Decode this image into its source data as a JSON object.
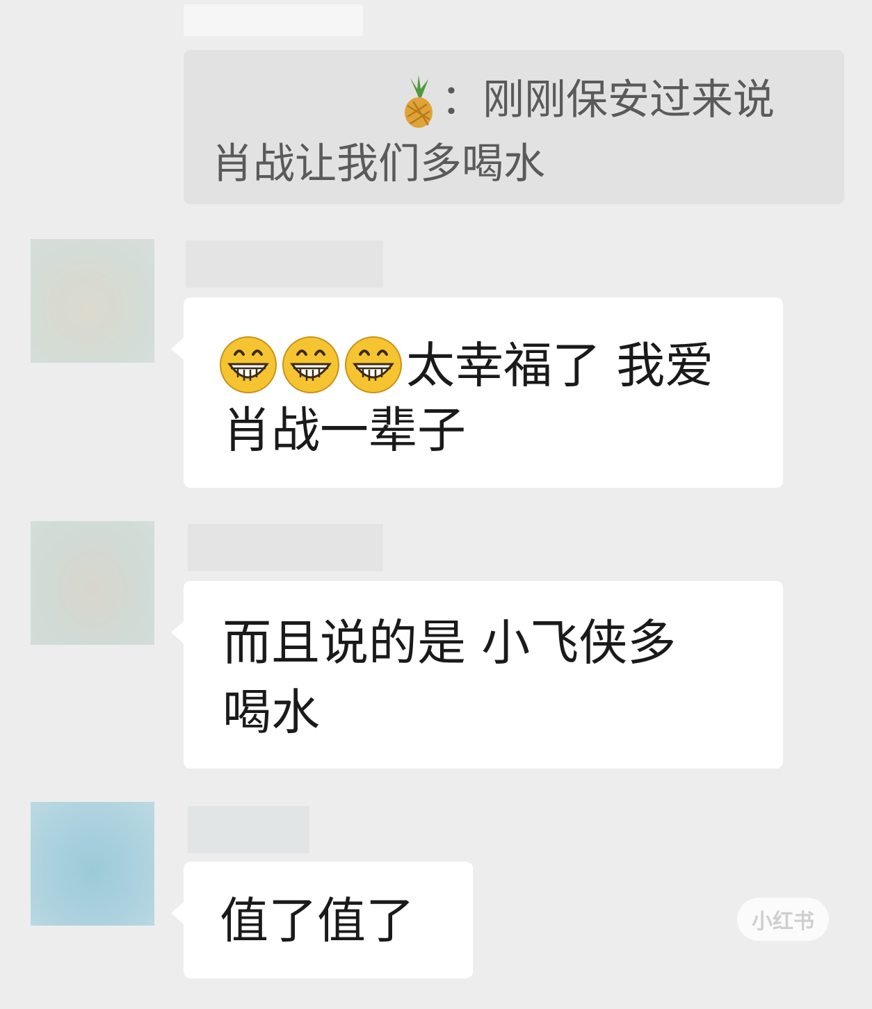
{
  "quote": {
    "emoji": "pineapple",
    "line1": "：刚刚保安过来说",
    "line2": "肖战让我们多喝水"
  },
  "messages": [
    {
      "emoji_count": 3,
      "emoji": "grinning-face",
      "line1": "太幸福了 我爱",
      "line2": "肖战一辈子"
    },
    {
      "line1": "而且说的是 小飞侠多",
      "line2": "喝水"
    },
    {
      "line1": "值了值了"
    }
  ],
  "watermark": "小红书",
  "colors": {
    "background": "#ededed",
    "bubble": "#ffffff",
    "quote_card": "#e2e2e2"
  }
}
